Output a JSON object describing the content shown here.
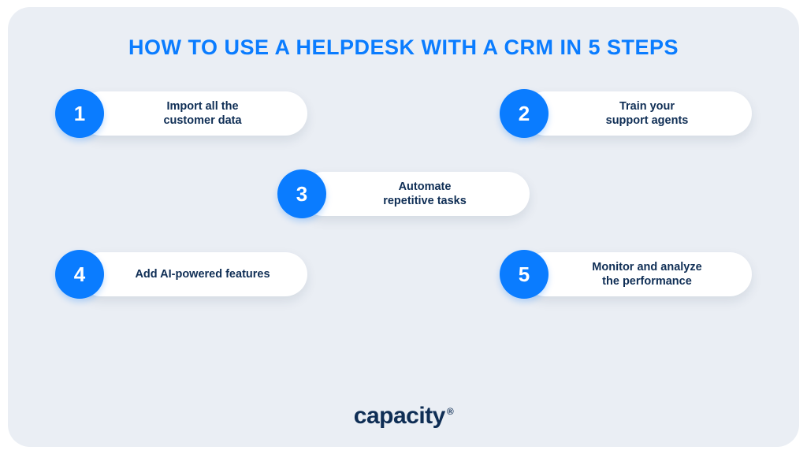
{
  "title": "HOW TO USE A HELPDESK WITH A CRM IN 5 STEPS",
  "steps": [
    {
      "num": "1",
      "label": "Import all the\ncustomer data"
    },
    {
      "num": "2",
      "label": "Train your\nsupport agents"
    },
    {
      "num": "3",
      "label": "Automate\nrepetitive tasks"
    },
    {
      "num": "4",
      "label": "Add AI-powered features"
    },
    {
      "num": "5",
      "label": "Monitor and analyze\nthe performance"
    }
  ],
  "brand": "capacity",
  "brandMark": "®",
  "colors": {
    "accent": "#0a7cff",
    "bg": "#eaeef4",
    "text": "#0f2e55"
  }
}
